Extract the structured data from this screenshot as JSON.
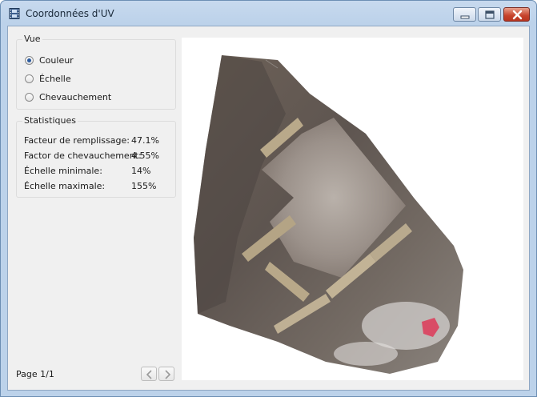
{
  "window": {
    "title": "Coordonnées d'UV",
    "frame_color": "#bcd2ea",
    "close_color": "#c6422b"
  },
  "icons": {
    "app": "film-strip-icon",
    "minimize": "minimize-icon",
    "maximize": "maximize-icon",
    "close": "close-icon",
    "prev": "chevron-left-icon",
    "next": "chevron-right-icon"
  },
  "view_group": {
    "label": "Vue",
    "options": [
      {
        "label": "Couleur",
        "selected": true
      },
      {
        "label": "Échelle",
        "selected": false
      },
      {
        "label": "Chevauchement",
        "selected": false
      }
    ]
  },
  "stats_group": {
    "label": "Statistiques",
    "rows": [
      {
        "key": "Facteur de remplissage:",
        "value": "47.1%"
      },
      {
        "key": "Factor de chevauchement:",
        "value": "4.55%"
      },
      {
        "key": "Échelle minimale:",
        "value": "14%"
      },
      {
        "key": "Échelle maximale:",
        "value": "155%"
      }
    ]
  },
  "pager": {
    "label": "Page 1/1"
  }
}
